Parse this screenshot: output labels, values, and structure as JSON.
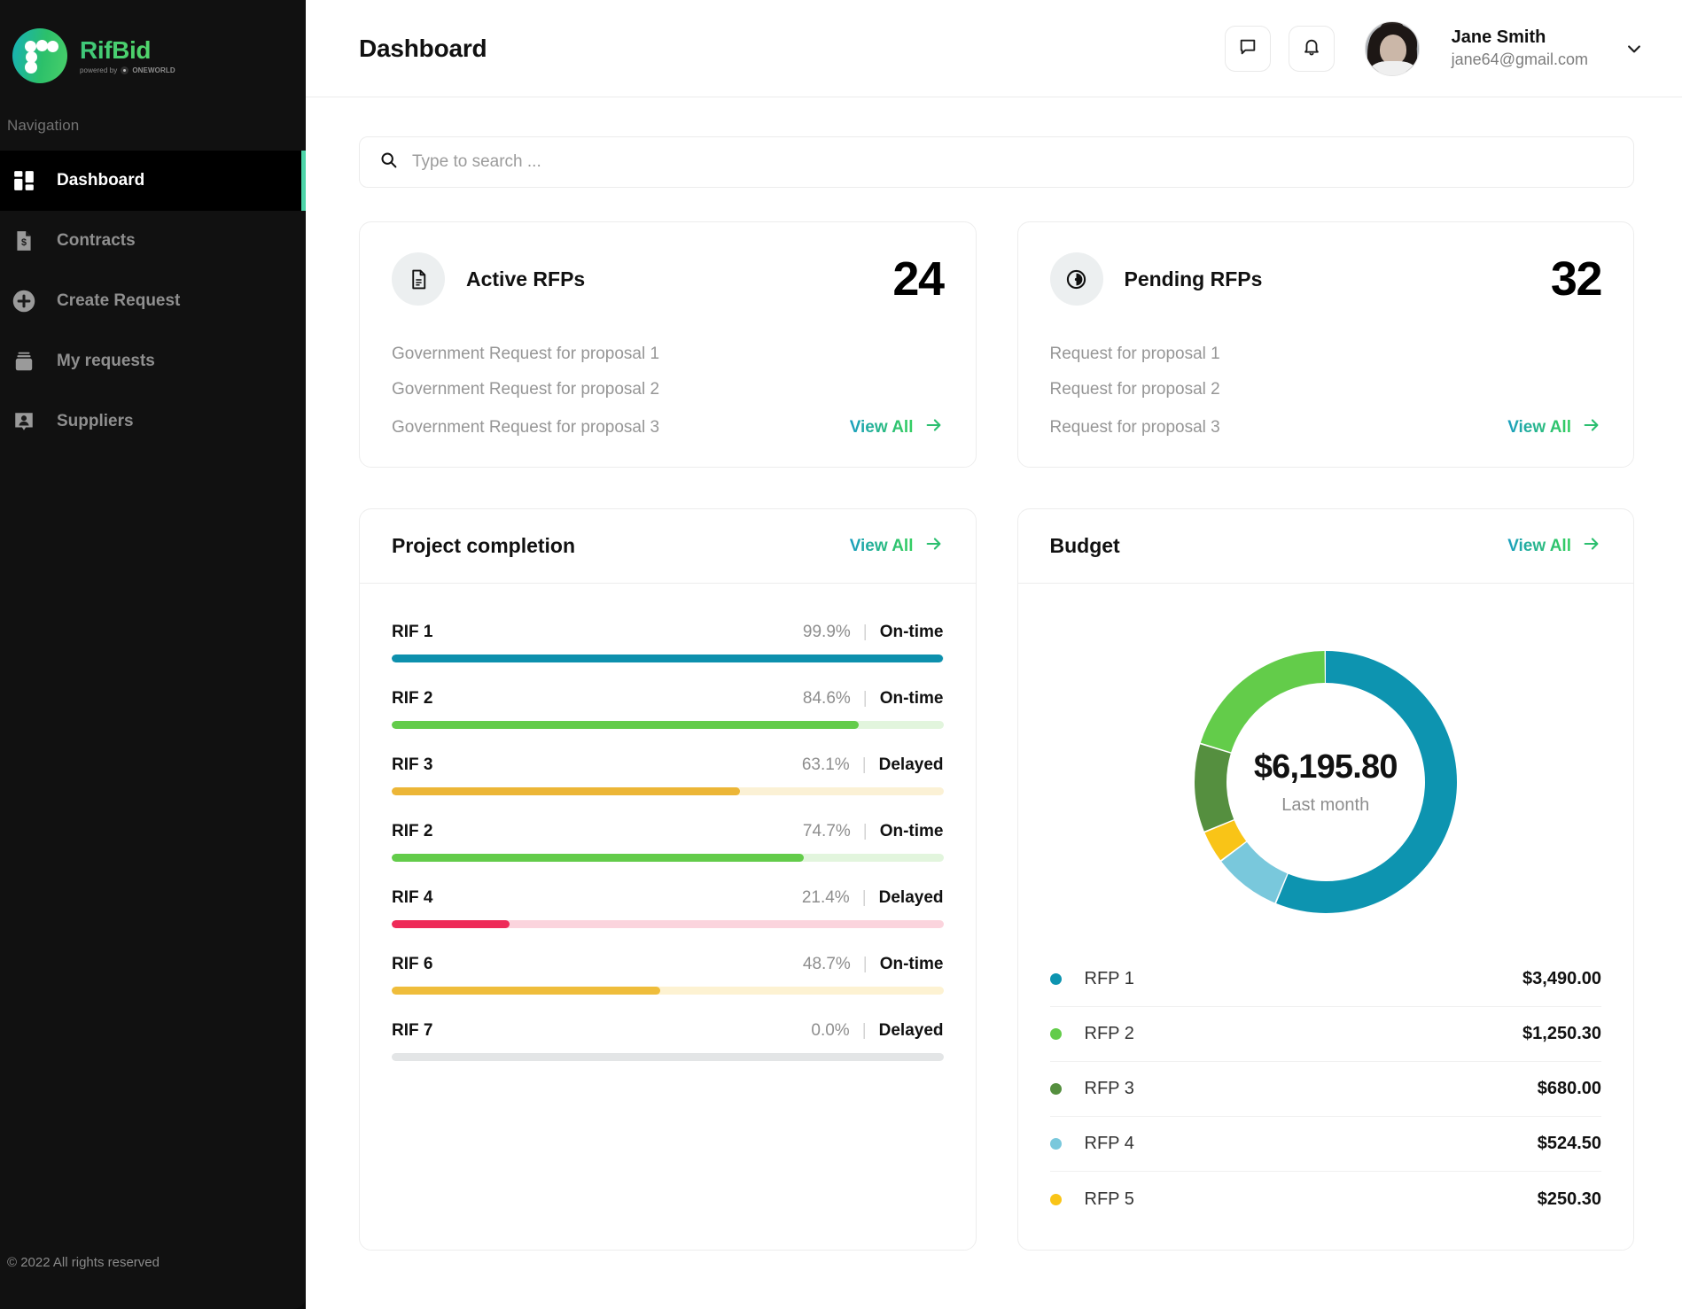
{
  "brand": {
    "name": "RifBid",
    "powered_prefix": "powered by",
    "powered_by": "ONEWORLD"
  },
  "sidebar": {
    "nav_caption": "Navigation",
    "items": [
      {
        "label": "Dashboard",
        "icon": "grid-icon",
        "active": true
      },
      {
        "label": "Contracts",
        "icon": "contract-dollar-icon",
        "active": false
      },
      {
        "label": "Create Request",
        "icon": "plus-circle-icon",
        "active": false
      },
      {
        "label": "My requests",
        "icon": "briefcase-icon",
        "active": false
      },
      {
        "label": "Suppliers",
        "icon": "user-badge-icon",
        "active": false
      }
    ],
    "footer": "© 2022 All rights reserved"
  },
  "header": {
    "title": "Dashboard",
    "messages_icon": "chat-bubble-icon",
    "notifications_icon": "bell-icon",
    "user": {
      "name": "Jane Smith",
      "email": "jane64@gmail.com"
    },
    "chevron_icon": "chevron-down-icon"
  },
  "search": {
    "icon": "search-icon",
    "placeholder": "Type to search ...",
    "value": ""
  },
  "stat_cards": [
    {
      "icon": "document-icon",
      "title": "Active RFPs",
      "value": "24",
      "items": [
        "Government Request for proposal 1",
        "Government Request for proposal 2",
        "Government Request for proposal 3"
      ],
      "view_all": "View All"
    },
    {
      "icon": "clock-half-icon",
      "title": "Pending RFPs",
      "value": "32",
      "items": [
        "Request for proposal  1",
        "Request for proposal  2",
        "Request for proposal  3"
      ],
      "view_all": "View All"
    }
  ],
  "project_completion": {
    "title": "Project completion",
    "view_all": "View All",
    "separator": "|",
    "rows": [
      {
        "name": "RIF 1",
        "percent": "99.9%",
        "value": 99.9,
        "status": "On-time",
        "color": "#0d90ad",
        "track": "#dff0f4"
      },
      {
        "name": "RIF 2",
        "percent": "84.6%",
        "value": 84.6,
        "status": "On-time",
        "color": "#63cc4a",
        "track": "#e2f5dd"
      },
      {
        "name": "RIF 3",
        "percent": "63.1%",
        "value": 63.1,
        "status": "Delayed",
        "color": "#ecb637",
        "track": "#fbf1d5"
      },
      {
        "name": "RIF 2",
        "percent": "74.7%",
        "value": 74.7,
        "status": "On-time",
        "color": "#63cc4a",
        "track": "#e2f5dd"
      },
      {
        "name": "RIF 4",
        "percent": "21.4%",
        "value": 21.4,
        "status": "Delayed",
        "color": "#ee2a58",
        "track": "#fbd4dd"
      },
      {
        "name": "RIF 6",
        "percent": "48.7%",
        "value": 48.7,
        "status": "On-time",
        "color": "#efbd3b",
        "track": "#fdf2d2"
      },
      {
        "name": "RIF 7",
        "percent": "0.0%",
        "value": 0.0,
        "status": "Delayed",
        "color": "#e3e5e6",
        "track": "#e3e5e6"
      }
    ]
  },
  "budget": {
    "title": "Budget",
    "view_all": "View All",
    "center_amount": "$6,195.80",
    "center_caption": "Last month"
  },
  "chart_data": {
    "type": "pie",
    "title": "Budget",
    "subtitle": "Last month",
    "center_label": "$6,195.80",
    "total": 6195.8,
    "legend_position": "bottom",
    "labels": [
      "RFP 1",
      "RFP 2",
      "RFP 3",
      "RFP 4",
      "RFP 5"
    ],
    "values": [
      3490.0,
      1250.3,
      680.0,
      524.5,
      250.3
    ],
    "value_labels": [
      "$3,490.00",
      "$1,250.30",
      "$680.00",
      "$524.50",
      "$250.30"
    ],
    "colors": [
      "#0d94b0",
      "#63cc4a",
      "#558f3f",
      "#79c8dc",
      "#f9c417"
    ],
    "slice_order_clockwise_from_top": [
      "RFP 1",
      "RFP 4",
      "RFP 5",
      "RFP 3",
      "RFP 2"
    ]
  },
  "palette": {
    "accent_green": "#4dd4a8",
    "link_gradient_start": "#1b9fc0",
    "link_gradient_end": "#35cf63",
    "sidebar_bg": "#111111",
    "sidebar_active_bg": "#000000"
  }
}
